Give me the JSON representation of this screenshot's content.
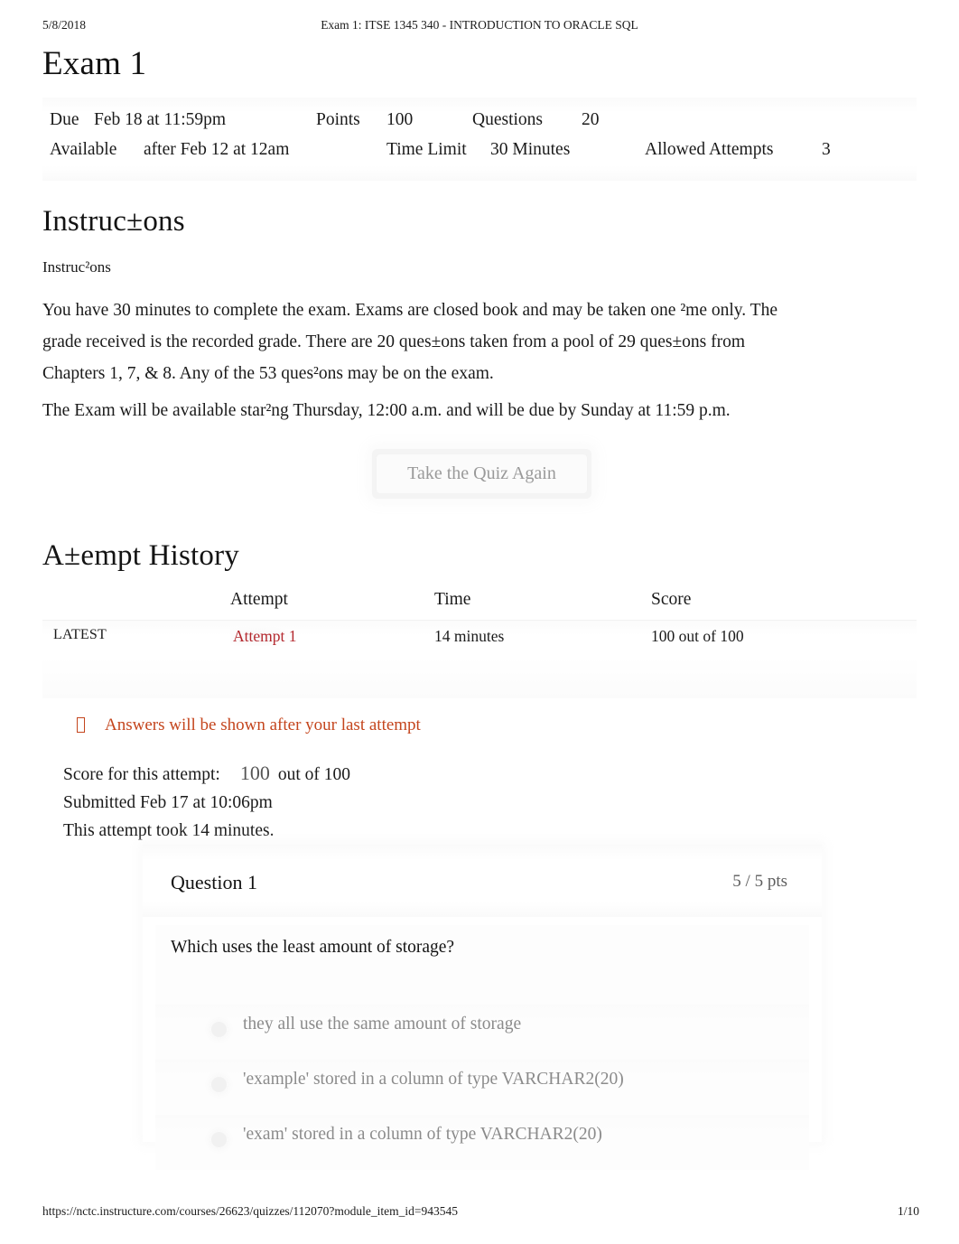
{
  "print_header": {
    "date": "5/8/2018",
    "document_title": "Exam 1: ITSE 1345 340 - INTRODUCTION TO ORACLE SQL"
  },
  "quiz": {
    "title": "Exam 1",
    "meta": {
      "due_label": "Due",
      "due_value": "Feb 18 at 11:59pm",
      "points_label": "Points",
      "points_value": "100",
      "questions_label": "Questions",
      "questions_value": "20",
      "available_label": "Available",
      "available_value": "after Feb 12 at 12am",
      "time_limit_label": "Time Limit",
      "time_limit_value": "30 Minutes",
      "allowed_attempts_label": "Allowed Attempts",
      "allowed_attempts_value": "3"
    }
  },
  "instructions": {
    "heading": "Instruc±ons",
    "subheading": "Instruc²ons",
    "paragraph_1": "You have 30 minutes to complete the exam. Exams are closed book and may be taken one ²me only. The grade received is the recorded grade.        There are 20 ques±ons taken from a pool of 29 ques±ons from Chapters 1, 7, & 8.     Any of the 53 ques²ons may be on the exam.",
    "paragraph_2": "The Exam will be available star²ng Thursday, 12:00 a.m. and will be due by Sunday at 11:59 p.m."
  },
  "retake": {
    "label": "Take the Quiz Again"
  },
  "attempt_history": {
    "heading": "A±empt History",
    "columns": [
      "",
      "Attempt",
      "Time",
      "Score"
    ],
    "rows": [
      {
        "kept": "LATEST",
        "attempt": "Attempt 1",
        "time": "14 minutes",
        "score": "100 out of 100"
      }
    ]
  },
  "answers_notice": {
    "icon": "info-box-icon",
    "text": "Answers will be shown after your last attempt",
    "color": "#c4451d"
  },
  "attempt_summary": {
    "score_label": "Score for this attempt:",
    "score_value": "100",
    "score_out_of": "out of 100",
    "submitted": "Submitted Feb 17 at 10:06pm",
    "duration": "This attempt took 14 minutes."
  },
  "question": {
    "title": "Question 1",
    "points": "5 / 5 pts",
    "prompt": "Which uses the least amount of storage?",
    "answers": [
      {
        "text": "they all use the same amount of storage"
      },
      {
        "text": "'example' stored in a column of type VARCHAR2(20)"
      },
      {
        "text": "'exam' stored in a column of type VARCHAR2(20)"
      }
    ]
  },
  "print_footer": {
    "url": "https://nctc.instructure.com/courses/26623/quizzes/112070?module_item_id=943545",
    "page": "1/10"
  }
}
